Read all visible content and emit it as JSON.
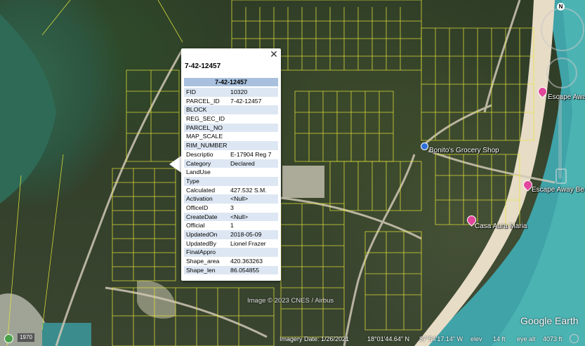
{
  "popup": {
    "title": "7-42-12457",
    "table_header": "7-42-12457",
    "close_glyph": "✕",
    "rows": [
      {
        "key": "FID",
        "value": "10320"
      },
      {
        "key": "PARCEL_ID",
        "value": "7-42-12457"
      },
      {
        "key": "BLOCK",
        "value": ""
      },
      {
        "key": "REG_SEC_ID",
        "value": ""
      },
      {
        "key": "PARCEL_NO",
        "value": ""
      },
      {
        "key": "MAP_SCALE",
        "value": ""
      },
      {
        "key": "RIM_NUMBER",
        "value": ""
      },
      {
        "key": "Descriptio",
        "value": "E-17904 Reg 7"
      },
      {
        "key": "Category",
        "value": "Declared"
      },
      {
        "key": "LandUse",
        "value": ""
      },
      {
        "key": "Type",
        "value": ""
      },
      {
        "key": "Calculated",
        "value": "427.532 S.M."
      },
      {
        "key": "Activation",
        "value": "<Null>"
      },
      {
        "key": "OfficeID",
        "value": "3"
      },
      {
        "key": "CreateDate",
        "value": "<Null>"
      },
      {
        "key": "Official",
        "value": "1"
      },
      {
        "key": "UpdatedOn",
        "value": "2018-05-09"
      },
      {
        "key": "UpdatedBy",
        "value": "Lionel Frazer"
      },
      {
        "key": "FinalAppro",
        "value": ""
      },
      {
        "key": "Shape_area",
        "value": "420.363263"
      },
      {
        "key": "Shape_len",
        "value": "86.054855"
      }
    ]
  },
  "places": {
    "grocery": "Bonito's Grocery Shop",
    "escape1": "Escape Away",
    "escape2": "Escape Away Be",
    "casa": "Casa Aura Maria"
  },
  "credit": "Image © 2023 CNES / Airbus",
  "brand": "Google Earth",
  "status": {
    "year": "1970",
    "imagery_date": "Imagery Date: 1/26/2021",
    "lat": "18°01'44.64\" N",
    "lon": "87°54'17.14\" W",
    "elev_label": "elev",
    "elev": "14 ft",
    "eye_alt": "eye alt",
    "eye_alt_value": "4073 ft"
  },
  "compass": "N",
  "colors": {
    "parcel_lines": "#e8e83a",
    "sea": "#3fa3a8",
    "pin": "#e2479c",
    "popup_header": "#a8c0dd"
  }
}
